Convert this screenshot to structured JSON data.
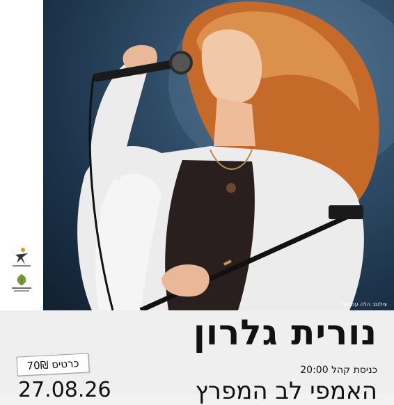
{
  "poster": {
    "artist_name": "נורית גלרון",
    "ticket_price": "כרטיס 70₪",
    "entry_time": "20:00",
    "entry_label": "כניסת קהל",
    "date": "27.08.26",
    "venue": "האמפי לב המפרץ",
    "photo_credit": "צילום: הלה עמנואל"
  },
  "logos": [
    {
      "name": "figure-logo-icon"
    },
    {
      "name": "leaf-logo-icon"
    }
  ],
  "colors": {
    "background": "#efefef",
    "photo_background": "#1b3249",
    "text": "#111111"
  }
}
